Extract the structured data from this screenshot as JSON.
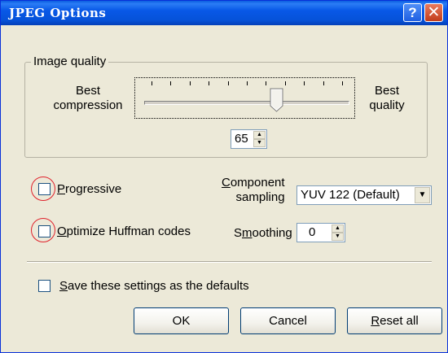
{
  "window": {
    "title": "JPEG Options",
    "help_glyph": "?",
    "close_glyph": "✕"
  },
  "quality": {
    "group_label": "Image quality",
    "left_label_line1": "Best",
    "left_label_line2": "compression",
    "right_label_line1": "Best",
    "right_label_line2": "quality",
    "value": "65",
    "slider_level_fraction": 0.65
  },
  "progressive": {
    "label_first": "P",
    "label_rest": "rogressive",
    "checked": false
  },
  "huffman": {
    "label_first": "O",
    "label_rest": "ptimize Huffman codes",
    "checked": false
  },
  "component": {
    "label_line1_first": "C",
    "label_line1_rest": "omponent",
    "label_line2": "sampling",
    "selected": "YUV 122 (Default)"
  },
  "smoothing": {
    "label_pre": "S",
    "label_u": "m",
    "label_post": "oothing",
    "value": "0"
  },
  "save_defaults": {
    "label_first": "S",
    "label_rest": "ave these settings as the defaults",
    "checked": false
  },
  "buttons": {
    "ok": "OK",
    "cancel": "Cancel",
    "reset_first": "R",
    "reset_rest": "eset all"
  },
  "icons": {
    "annotation": "red-circle-highlight",
    "spin": "spin-up-down-icon",
    "dropdown": "chevron-down-icon"
  }
}
